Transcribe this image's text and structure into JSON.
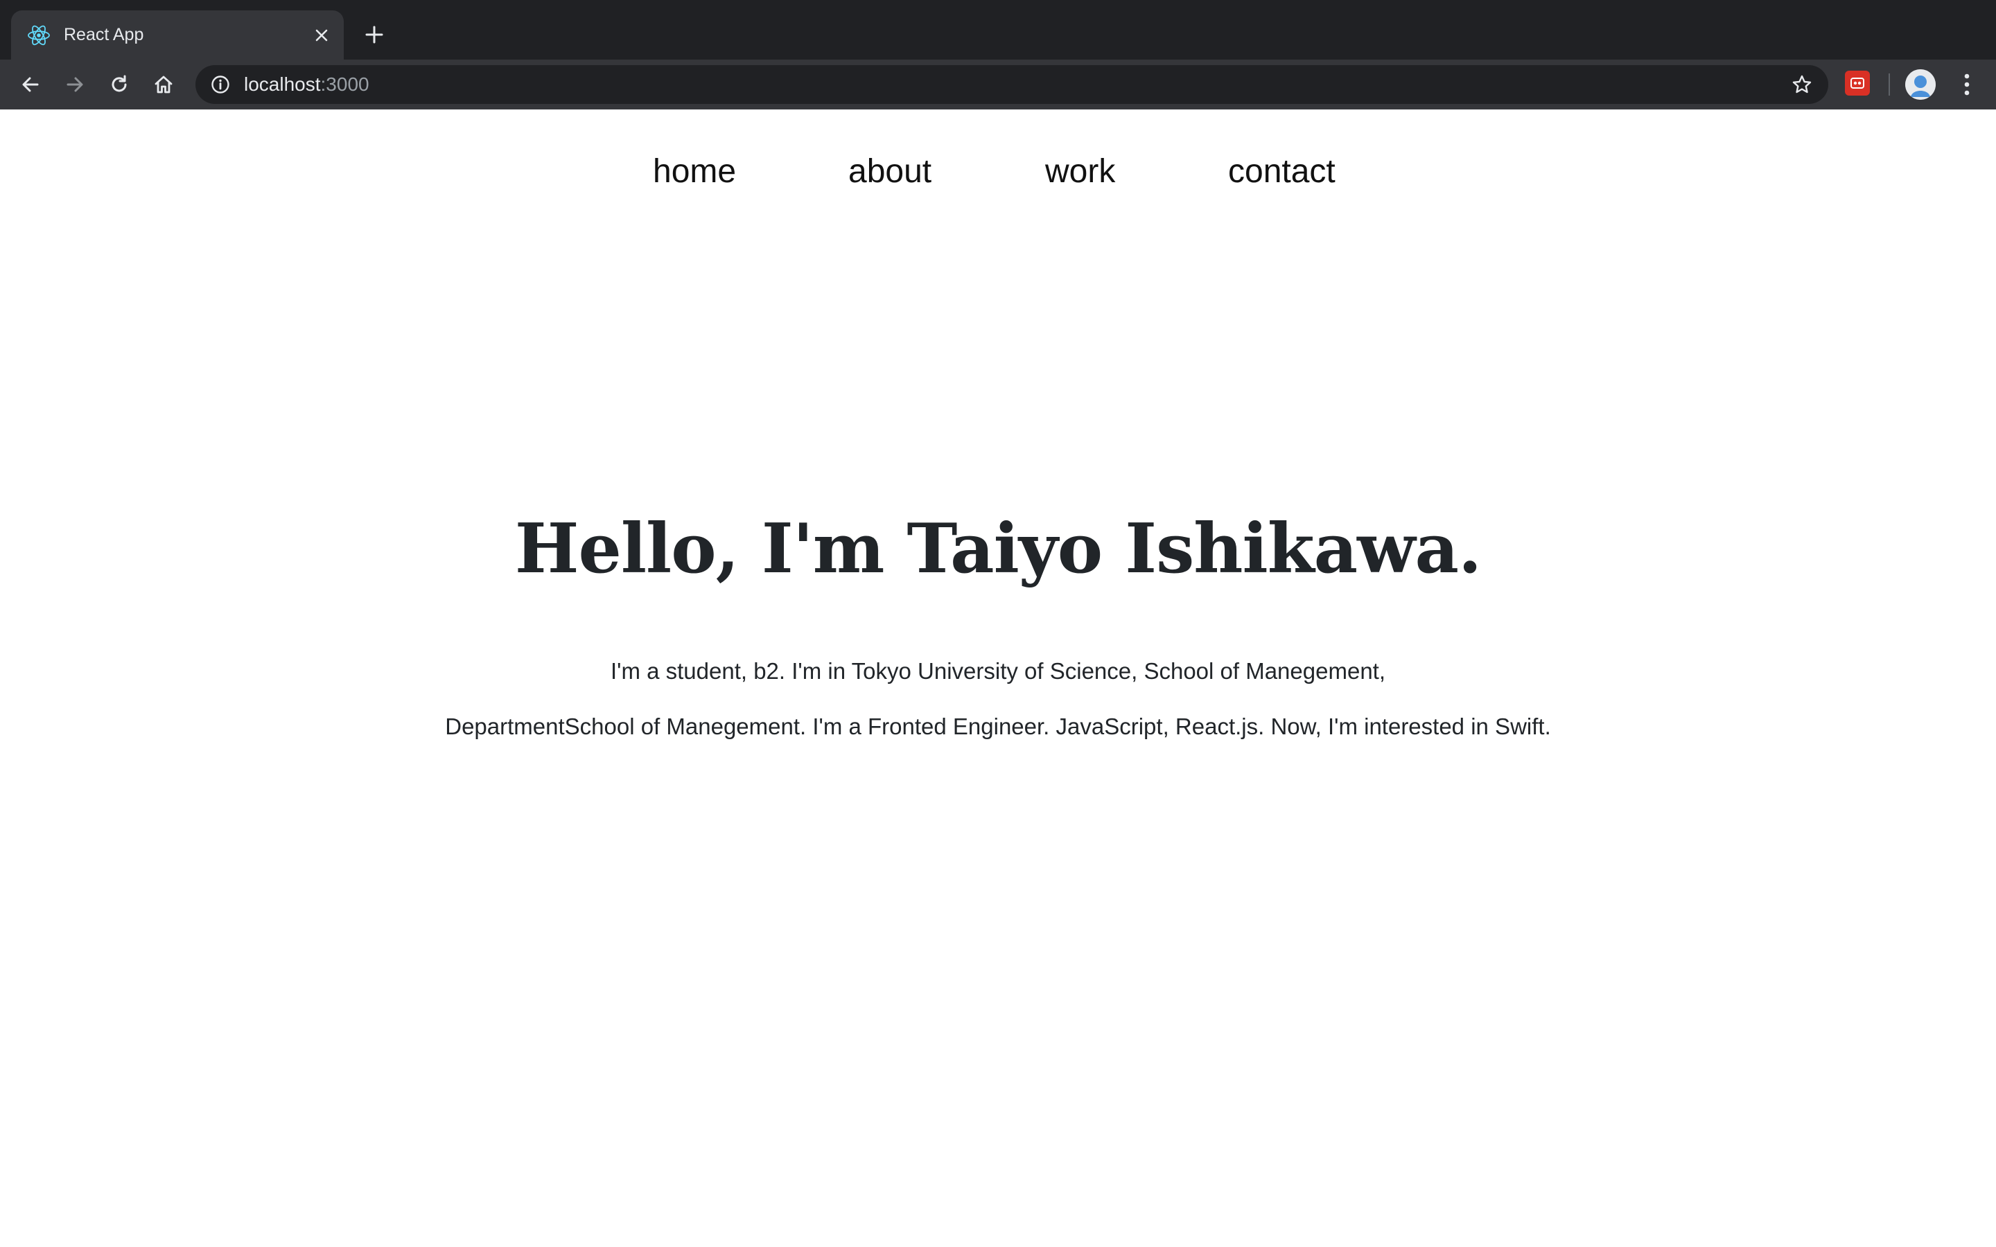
{
  "browser": {
    "tab_title": "React App",
    "url_host": "localhost",
    "url_port": ":3000"
  },
  "nav": {
    "items": [
      {
        "label": "home"
      },
      {
        "label": "about"
      },
      {
        "label": "work"
      },
      {
        "label": "contact"
      }
    ]
  },
  "hero": {
    "title": "Hello, I'm Taiyo Ishikawa.",
    "line1": "I'm a student, b2. I'm in Tokyo University of Science, School of Manegement,",
    "line2": "DepartmentSchool of Manegement. I'm a Fronted Engineer. JavaScript, React.js. Now, I'm interested in Swift."
  },
  "icons": {
    "favicon": "react-logo-icon",
    "close": "close-icon",
    "new_tab": "plus-icon",
    "back": "back-arrow-icon",
    "forward": "forward-arrow-icon",
    "reload": "reload-icon",
    "home": "home-icon",
    "info": "info-icon",
    "bookmark": "star-icon",
    "extension": "extension-icon",
    "profile": "avatar",
    "menu": "kebab-menu-icon"
  },
  "colors": {
    "chrome_dark": "#202124",
    "chrome_toolbar": "#35363a",
    "text": "#212529",
    "react_cyan": "#61dafb"
  }
}
